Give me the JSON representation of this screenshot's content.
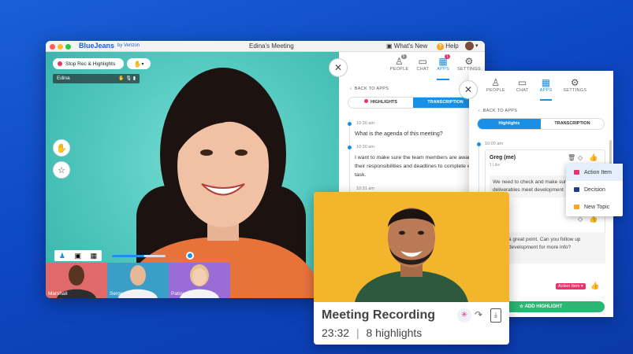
{
  "window": {
    "brand": "BlueJeans",
    "brand_suffix": "by Verizon",
    "title": "Edina's Meeting",
    "whats_new": "What's New",
    "help": "Help"
  },
  "video": {
    "stop_rec_label": "Stop Rec & Highlights",
    "speaker_name": "Edina",
    "participants": [
      {
        "name": "Marshall"
      },
      {
        "name": "Serge"
      },
      {
        "name": "Patsy"
      }
    ],
    "volume_fraction": 0.6
  },
  "panel1": {
    "tabs": [
      {
        "label": "PEOPLE",
        "badge": "5"
      },
      {
        "label": "CHAT"
      },
      {
        "label": "APPS",
        "badge": "1"
      },
      {
        "label": "SETTINGS"
      }
    ],
    "back": "BACK TO APPS",
    "seg_highlights": "HIGHLIGHTS",
    "seg_transcription": "TRANSCRIPTION",
    "entries": [
      {
        "time": "10:30 am",
        "text": "What is the agenda of this meeting?"
      },
      {
        "time": "10:30 am",
        "text": "I want to make sure the team members are aware of their responsibilities and deadlines to complete each task."
      },
      {
        "time": "10:31 am",
        "text": ""
      }
    ]
  },
  "panel2": {
    "tabs": [
      {
        "label": "PEOPLE"
      },
      {
        "label": "CHAT"
      },
      {
        "label": "APPS"
      },
      {
        "label": "SETTINGS"
      }
    ],
    "back": "BACK TO APPS",
    "seg_highlights": "Highlights",
    "seg_transcription": "TRANSCRIPTION",
    "time": "10:00 am",
    "author": "Greg (me)",
    "likes": "1 Like",
    "msg1": "We need to check and make sure all the deliverables meet development",
    "msg2": "a great point. Can you follow up development for more info?",
    "tag": "Action Item",
    "add_highlight": "ADD HIGHLIGHT"
  },
  "dropdown": {
    "items": [
      {
        "label": "Action Item",
        "color": "#e8336d"
      },
      {
        "label": "Decision",
        "color": "#1f3c88"
      },
      {
        "label": "New Topic",
        "color": "#f5a623"
      }
    ]
  },
  "recording": {
    "title": "Meeting Recording",
    "duration": "23:32",
    "separator": "|",
    "highlights": "8 highlights"
  },
  "colors": {
    "accent": "#1a8fe3",
    "record": "#e8336d",
    "green": "#2bb673"
  }
}
